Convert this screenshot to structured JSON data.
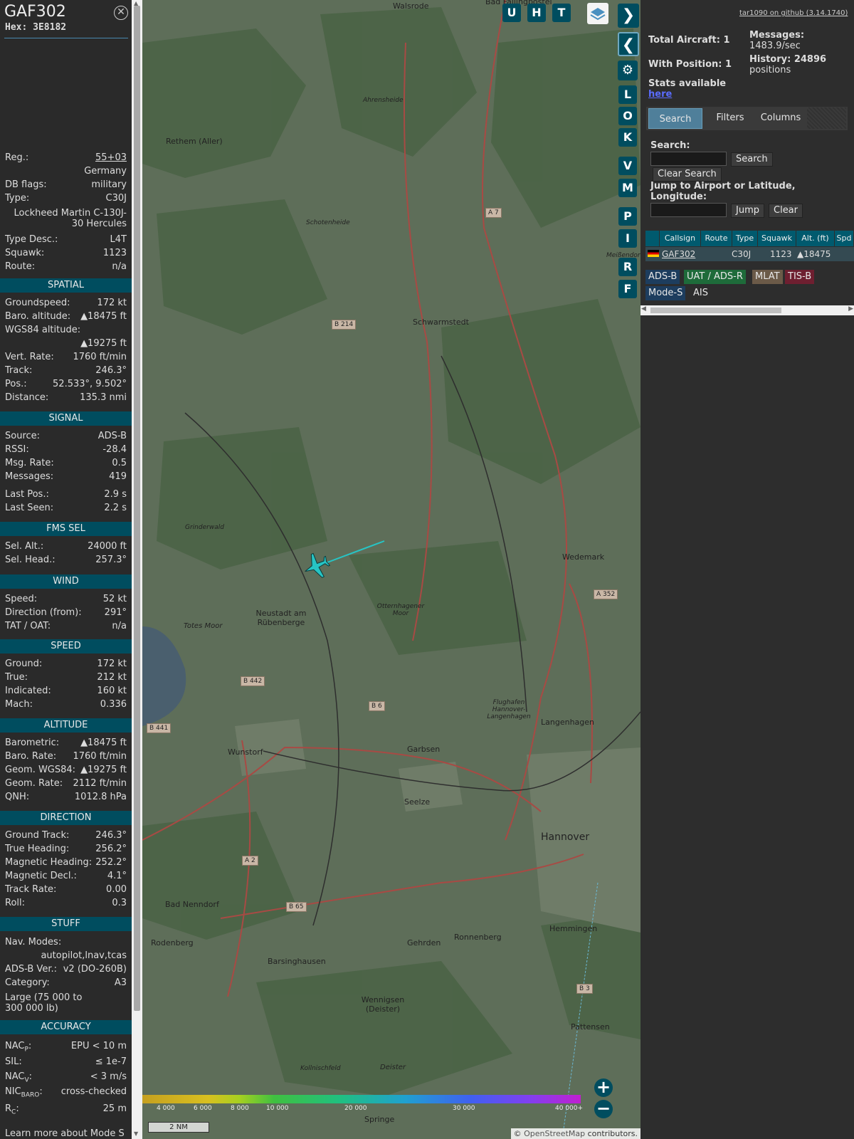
{
  "aircraft": {
    "callsign": "GAF302",
    "hex": "Hex: 3E8182",
    "close_icon": "close-circle-icon",
    "reg_label": "Reg.:",
    "reg": "55+03",
    "country": "Germany",
    "db_flags_label": "DB flags:",
    "db_flags": "military",
    "type_label": "Type:",
    "type": "C30J",
    "type_long": "Lockheed Martin C-130J-30 Hercules",
    "type_desc_label": "Type Desc.:",
    "type_desc": "L4T",
    "squawk_label": "Squawk:",
    "squawk": "1123",
    "route_label": "Route:",
    "route": "n/a"
  },
  "spatial": {
    "header": "SPATIAL",
    "rows": [
      {
        "k": "Groundspeed:",
        "v": "172 kt"
      },
      {
        "k": "Baro. altitude:",
        "v": "▲18475 ft"
      },
      {
        "k": "WGS84 altitude:",
        "v": ""
      },
      {
        "k": "",
        "v": "▲19275 ft"
      },
      {
        "k": "Vert. Rate:",
        "v": "1760 ft/min"
      },
      {
        "k": "Track:",
        "v": "246.3°"
      },
      {
        "k": "Pos.:",
        "v": "52.533°, 9.502°"
      },
      {
        "k": "Distance:",
        "v": "135.3 nmi"
      }
    ]
  },
  "signal": {
    "header": "SIGNAL",
    "rows": [
      {
        "k": "Source:",
        "v": "ADS-B"
      },
      {
        "k": "RSSI:",
        "v": "-28.4"
      },
      {
        "k": "Msg. Rate:",
        "v": "0.5"
      },
      {
        "k": "Messages:",
        "v": "419"
      },
      {
        "k": "Last Pos.:",
        "v": "2.9 s"
      },
      {
        "k": "Last Seen:",
        "v": "2.2 s"
      }
    ]
  },
  "fms": {
    "header": "FMS SEL",
    "rows": [
      {
        "k": "Sel. Alt.:",
        "v": "24000 ft"
      },
      {
        "k": "Sel. Head.:",
        "v": "257.3°"
      }
    ]
  },
  "wind": {
    "header": "WIND",
    "rows": [
      {
        "k": "Speed:",
        "v": "52 kt"
      },
      {
        "k": "Direction (from):",
        "v": "291°"
      },
      {
        "k": "TAT / OAT:",
        "v": "n/a"
      }
    ]
  },
  "speed": {
    "header": "SPEED",
    "rows": [
      {
        "k": "Ground:",
        "v": "172 kt"
      },
      {
        "k": "True:",
        "v": "212 kt"
      },
      {
        "k": "Indicated:",
        "v": "160 kt"
      },
      {
        "k": "Mach:",
        "v": "0.336"
      }
    ]
  },
  "altitude": {
    "header": "ALTITUDE",
    "rows": [
      {
        "k": "Barometric:",
        "v": "▲18475 ft"
      },
      {
        "k": "Baro. Rate:",
        "v": "1760 ft/min"
      },
      {
        "k": "Geom. WGS84:",
        "v": "▲19275 ft"
      },
      {
        "k": "Geom. Rate:",
        "v": "2112 ft/min"
      },
      {
        "k": "QNH:",
        "v": "1012.8 hPa"
      }
    ]
  },
  "direction": {
    "header": "DIRECTION",
    "rows": [
      {
        "k": "Ground Track:",
        "v": "246.3°"
      },
      {
        "k": "True Heading:",
        "v": "256.2°"
      },
      {
        "k": "Magnetic Heading:",
        "v": "252.2°"
      },
      {
        "k": "Magnetic Decl.:",
        "v": "4.1°"
      },
      {
        "k": "Track Rate:",
        "v": "0.00"
      },
      {
        "k": "Roll:",
        "v": "0.3"
      }
    ]
  },
  "stuff": {
    "header": "STUFF",
    "nav_modes_label": "Nav. Modes:",
    "nav_modes": "autopilot,lnav,tcas",
    "adsb_ver_label": "ADS-B Ver.:",
    "adsb_ver": "v2 (DO-260B)",
    "category_label": "Category:",
    "category": "A3",
    "category_desc": "Large (75 000 to 300 000 lb)"
  },
  "accuracy": {
    "header": "ACCURACY",
    "nacp_label": "NAC",
    "nacp_sub": "P",
    "nacp": "EPU < 10 m",
    "sil_label": "SIL:",
    "sil": "≤ 1e-7",
    "nacv_label": "NAC",
    "nacv_sub": "V",
    "nacv": "< 3 m/s",
    "nic_label": "NIC",
    "nic_sub": "BARO",
    "nic": "cross-checked",
    "rc_label": "R",
    "rc_sub": "C",
    "rc": "25 m",
    "learn_more": "Learn more about Mode S"
  },
  "map": {
    "places": [
      "Walsrode",
      "Bad Fallingbostel",
      "Ahrensheide",
      "Rethem (Aller)",
      "Schotenheide",
      "Schwarmstedt",
      "Grinderwald",
      "Wedemark",
      "Neustadt am Rübenberge",
      "Totes Moor",
      "Otternhagener Moor",
      "Flughafen Hannover-Langenhagen",
      "Langenhagen",
      "Wunstorf",
      "Garbsen",
      "Seelze",
      "Hannover",
      "Bad Nenndorf",
      "Rodenberg",
      "Barsinghausen",
      "Gehrden",
      "Ronnenberg",
      "Hemmingen",
      "Wennigsen (Deister)",
      "Pattensen",
      "Kollnischfeld",
      "Deister",
      "Springe",
      "Meißendorf"
    ],
    "roads": [
      "A 7",
      "B 214",
      "A 352",
      "B 442",
      "B 6",
      "B 441",
      "A 2",
      "B 65",
      "B 3"
    ],
    "buttons": [
      "U",
      "H",
      "T"
    ],
    "side_buttons": [
      "L",
      "O",
      "K",
      "V",
      "M",
      "P",
      "I",
      "R",
      "F"
    ],
    "scale_label": "2 NM",
    "altitude_ticks": [
      "4 000",
      "6 000",
      "8 000",
      "10 000",
      "20 000",
      "30 000",
      "40 000+"
    ],
    "attribution_prefix": "© ",
    "attribution_link": "OpenStreetMap",
    "attribution_suffix": " contributors.",
    "zoom_in": "+",
    "zoom_out": "−"
  },
  "stats": {
    "github": "tar1090 on github (3.14.1740)",
    "total_aircraft": "Total Aircraft: 1",
    "with_position": "With Position: 1",
    "messages_label": "Messages:",
    "messages_rate": "1483.9/sec",
    "history_label": "History: 24896",
    "history_unit": "positions",
    "stats_text": "Stats available",
    "stats_link": "here"
  },
  "tabs": [
    "Search",
    "Filters",
    "Columns"
  ],
  "search": {
    "label": "Search:",
    "button": "Search",
    "clear": "Clear Search",
    "jump_label": "Jump to Airport or Latitude, Longitude:",
    "jump": "Jump",
    "clear2": "Clear"
  },
  "table": {
    "headers": [
      "Callsign",
      "Route",
      "Type",
      "Squawk",
      "Alt. (ft)",
      "Spd"
    ],
    "row": {
      "callsign": "GAF302",
      "route": "",
      "type": "C30J",
      "squawk": "1123",
      "alt": "▲18475"
    }
  },
  "legend": [
    "ADS-B",
    "UAT / ADS-R",
    "MLAT",
    "TIS-B",
    "Mode-S",
    "AIS"
  ],
  "colors": {
    "accent": "#004d5f",
    "track": "#27c4c4",
    "adsb": "#1d3d5e",
    "uat": "#1e6b3a",
    "mlat": "#6b5a48",
    "tisb": "#6e1f30"
  }
}
